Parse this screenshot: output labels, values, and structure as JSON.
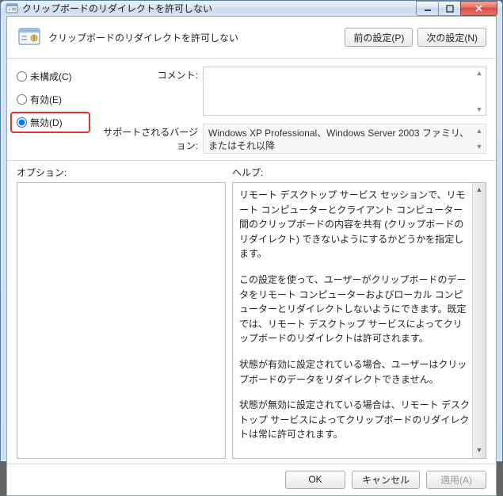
{
  "window": {
    "title": "クリップボードのリダイレクトを許可しない"
  },
  "header": {
    "title": "クリップボードのリダイレクトを許可しない",
    "prev_btn": "前の設定(P)",
    "next_btn": "次の設定(N)"
  },
  "radios": {
    "not_configured": "未構成(C)",
    "enabled": "有効(E)",
    "disabled": "無効(D)",
    "selected": "disabled"
  },
  "comment": {
    "label": "コメント:",
    "value": ""
  },
  "supported": {
    "label": "サポートされるバージョン:",
    "text": "Windows XP Professional、Windows Server 2003 ファミリ、またはそれ以降"
  },
  "labels": {
    "options": "オプション:",
    "help": "ヘルプ:"
  },
  "help_paragraphs": [
    "リモート デスクトップ サービス セッションで、リモート コンピューターとクライアント コンピューター間のクリップボードの内容を共有 (クリップボードのリダイレクト) できないようにするかどうかを指定します。",
    "この設定を使って、ユーザーがクリップボードのデータをリモート コンピューターおよびローカル コンピューターとリダイレクトしないようにできます。既定では、リモート デスクトップ サービスによってクリップボードのリダイレクトは許可されます。",
    "状態が有効に設定されている場合、ユーザーはクリップボードのデータをリダイレクトできません。",
    "状態が無効に設定されている場合は、リモート デスクトップ サービスによってクリップボードのリダイレクトは常に許可されます。"
  ],
  "footer": {
    "ok": "OK",
    "cancel": "キャンセル",
    "apply": "適用(A)"
  }
}
